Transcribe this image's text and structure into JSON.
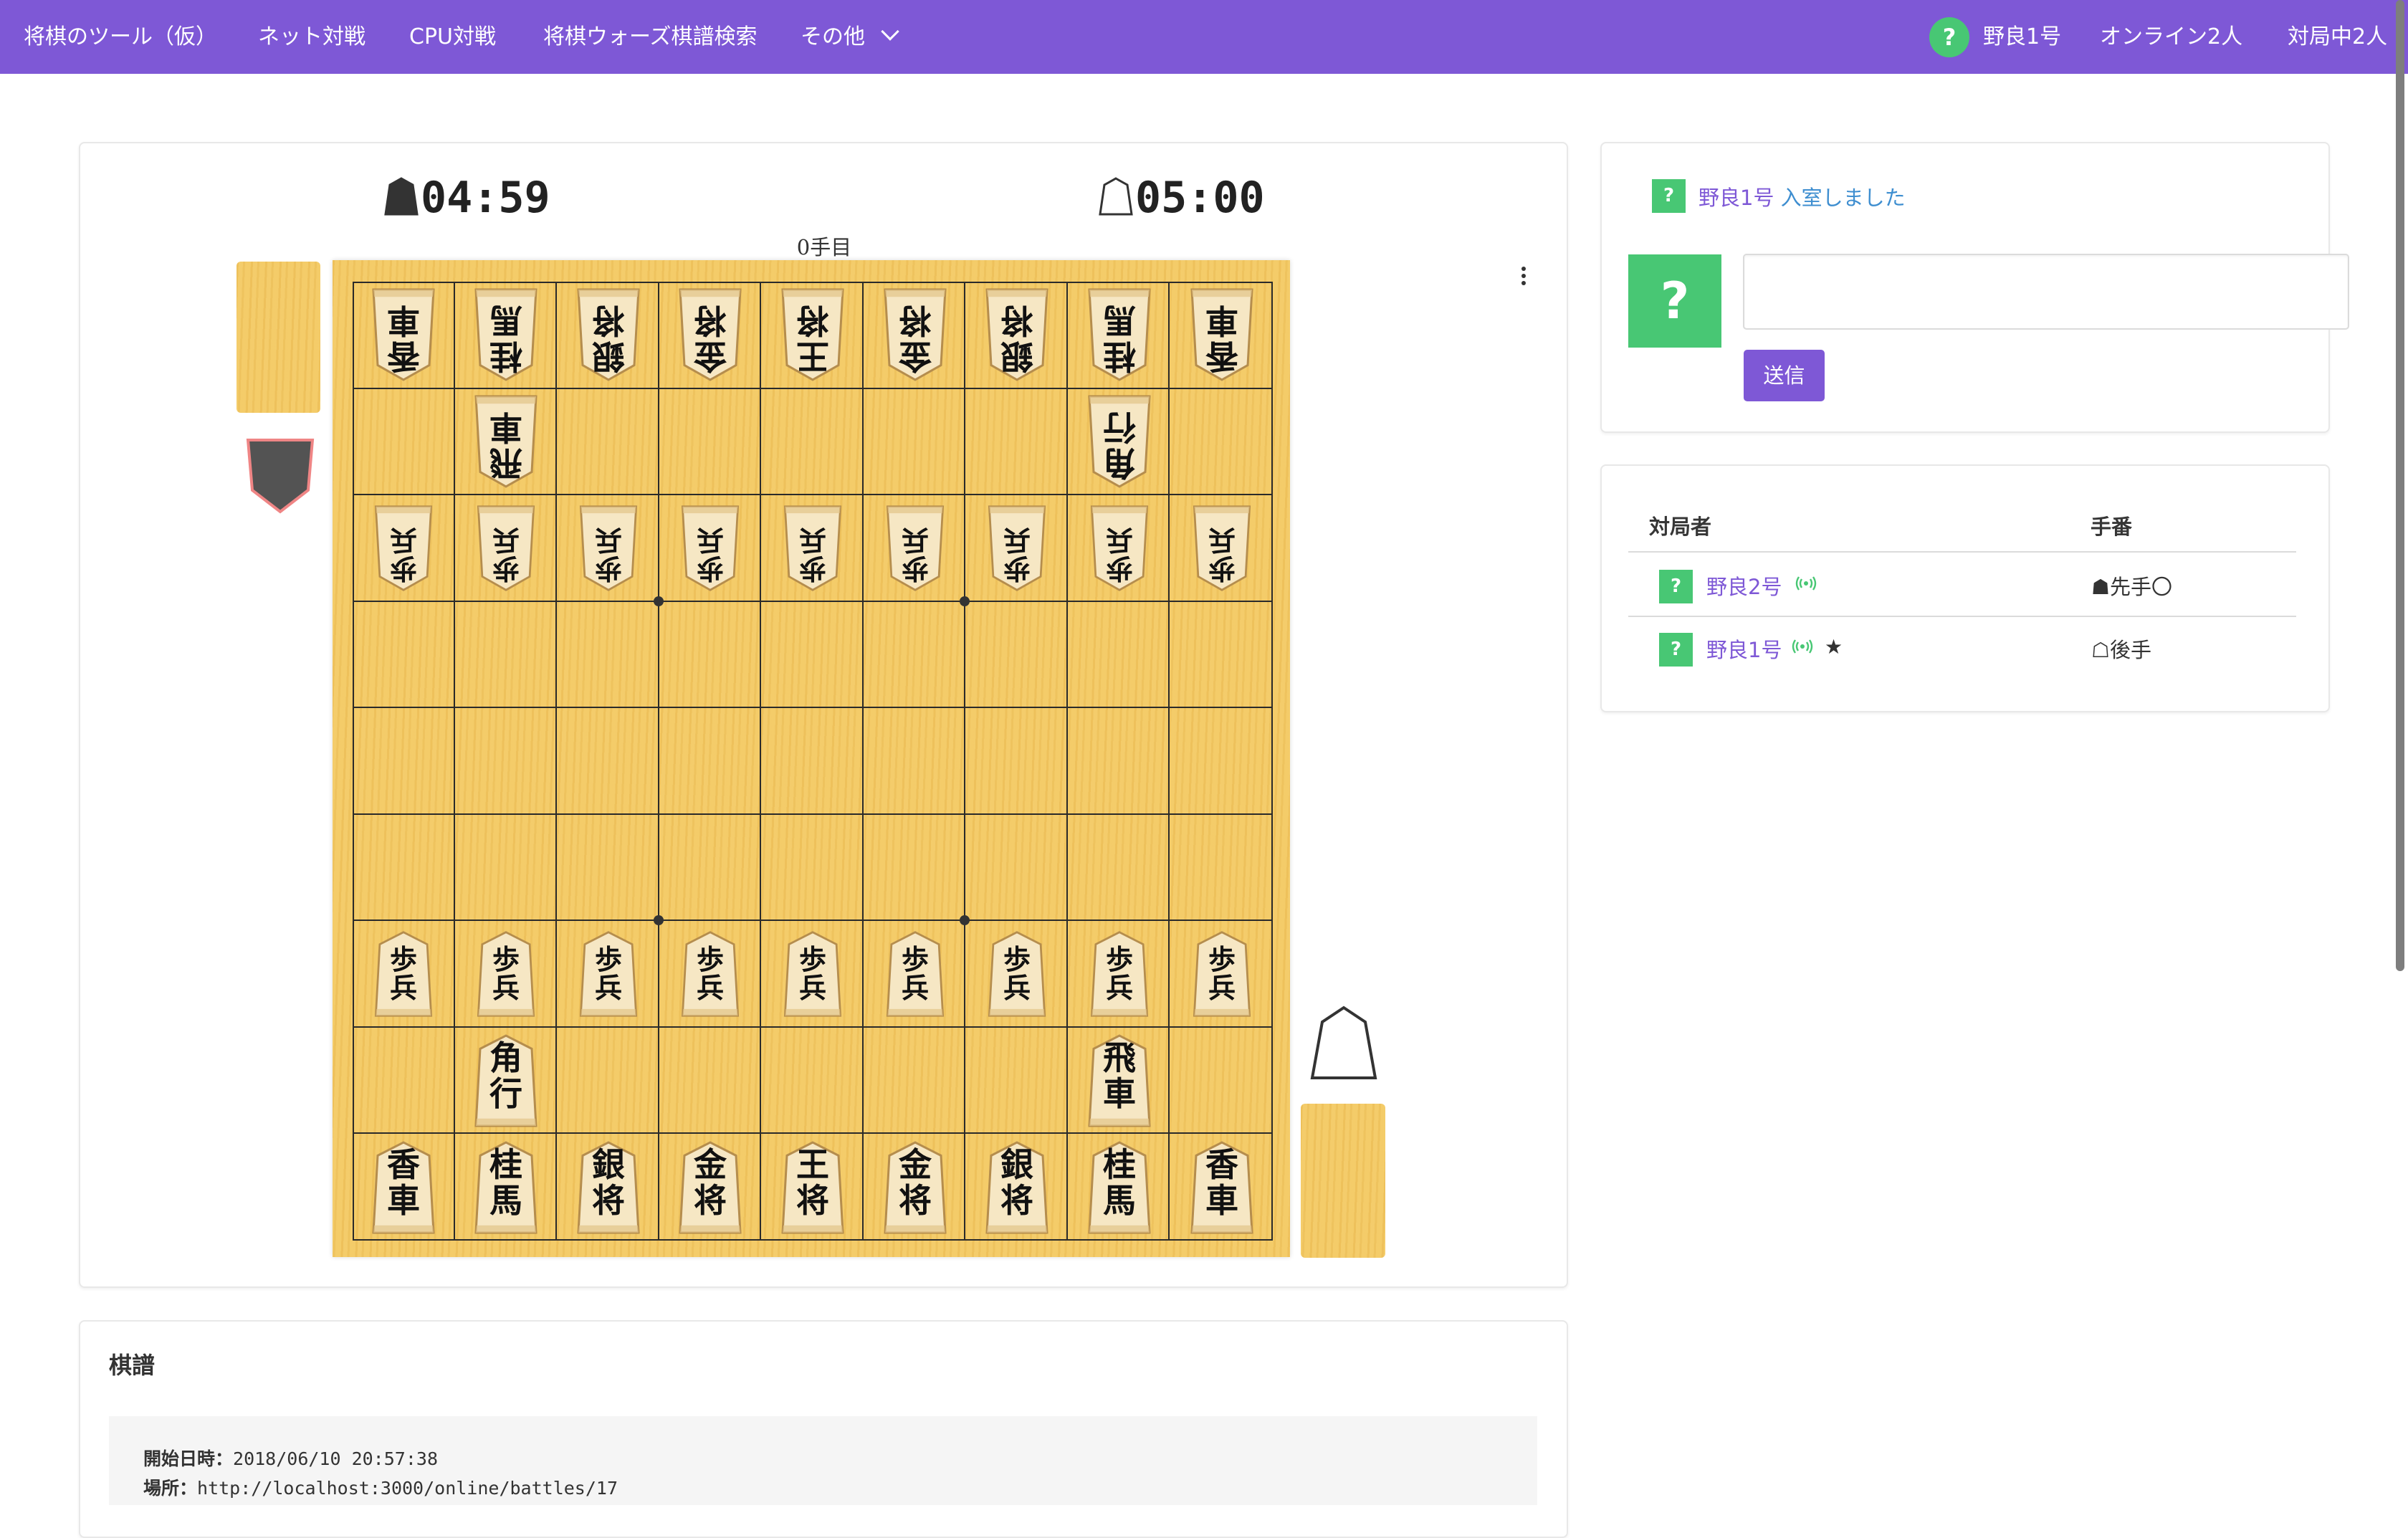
{
  "nav": {
    "brand": "将棋のツール（仮）",
    "items": [
      "ネット対戦",
      "CPU対戦",
      "将棋ウォーズ棋譜検索",
      "その他"
    ],
    "user_avatar": "?",
    "user_name": "野良1号",
    "online": "オンライン2人",
    "playing": "対局中2人",
    "accent_color": "#7e58d6"
  },
  "game": {
    "sente_clock": "04:59",
    "gote_clock": "05:00",
    "move_count": "0手目",
    "board": {
      "gote_back": [
        [
          "香",
          "車"
        ],
        [
          "桂",
          "馬"
        ],
        [
          "銀",
          "将"
        ],
        [
          "金",
          "将"
        ],
        [
          "王",
          "将"
        ],
        [
          "金",
          "将"
        ],
        [
          "銀",
          "将"
        ],
        [
          "桂",
          "馬"
        ],
        [
          "香",
          "車"
        ]
      ],
      "gote_rook": [
        "飛",
        "車"
      ],
      "gote_bishop": [
        "角",
        "行"
      ],
      "pawn": [
        "歩",
        "兵"
      ],
      "sente_bishop": [
        "角",
        "行"
      ],
      "sente_rook": [
        "飛",
        "車"
      ],
      "sente_back": [
        [
          "香",
          "車"
        ],
        [
          "桂",
          "馬"
        ],
        [
          "銀",
          "将"
        ],
        [
          "金",
          "将"
        ],
        [
          "王",
          "将"
        ],
        [
          "金",
          "将"
        ],
        [
          "銀",
          "将"
        ],
        [
          "桂",
          "馬"
        ],
        [
          "香",
          "車"
        ]
      ]
    }
  },
  "kifu": {
    "title": "棋譜",
    "lines": [
      {
        "label": "開始日時：",
        "value": "2018/06/10 20:57:38"
      },
      {
        "label": "場所：",
        "value": "http://localhost:3000/online/battles/17"
      }
    ]
  },
  "chat": {
    "avatar": "?",
    "message_user": "野良1号",
    "message_text": "入室しました",
    "input_value": "",
    "send_label": "送信"
  },
  "members": {
    "headers": {
      "player": "対局者",
      "turn": "手番"
    },
    "rows": [
      {
        "avatar": "?",
        "name": "野良2号",
        "turn": "☗先手〇",
        "star": ""
      },
      {
        "avatar": "?",
        "name": "野良1号",
        "turn": "☖後手",
        "star": "★"
      }
    ]
  },
  "icons": [
    "help-icon",
    "chevron-down-icon",
    "sente-piece-icon",
    "gote-piece-icon",
    "more-vertical-icon",
    "wifi-signal-icon",
    "star-icon"
  ]
}
